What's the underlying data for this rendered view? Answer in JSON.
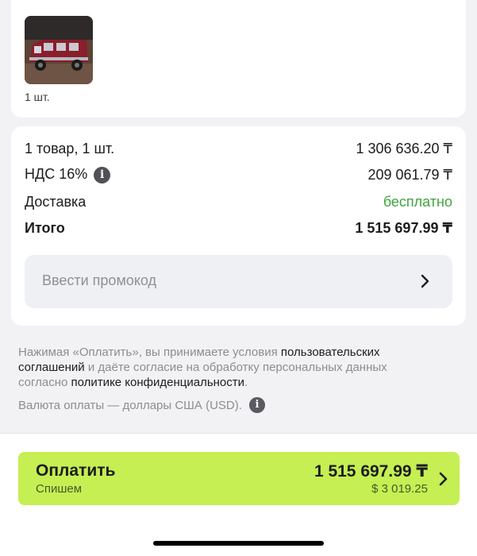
{
  "item": {
    "quantity_label": "1 шт."
  },
  "summary": {
    "goods_label": "1 товар, 1 шт.",
    "goods_value": "1 306 636.20 ₸",
    "vat_label": "НДС 16%",
    "vat_value": "209 061.79 ₸",
    "delivery_label": "Доставка",
    "delivery_value": "бесплатно",
    "total_label": "Итого",
    "total_value": "1 515 697.99 ₸"
  },
  "promo": {
    "placeholder": "Ввести промокод"
  },
  "legal": {
    "part1": "Нажимая «Оплатить», вы принимаете условия ",
    "link1": "пользовательских соглашений",
    "part2": " и даёте согласие на обработку персональных данных согласно ",
    "link2": "политике конфиденциальности",
    "part3": "."
  },
  "currency_note": "Валюта оплаты — доллары США (USD).",
  "pay": {
    "title": "Оплатить",
    "subtitle": "Спишем",
    "amount": "1 515 697.99 ₸",
    "amount_usd": "$ 3 019.25"
  },
  "colors": {
    "accent": "#c5ef52",
    "free": "#3fa53f"
  }
}
